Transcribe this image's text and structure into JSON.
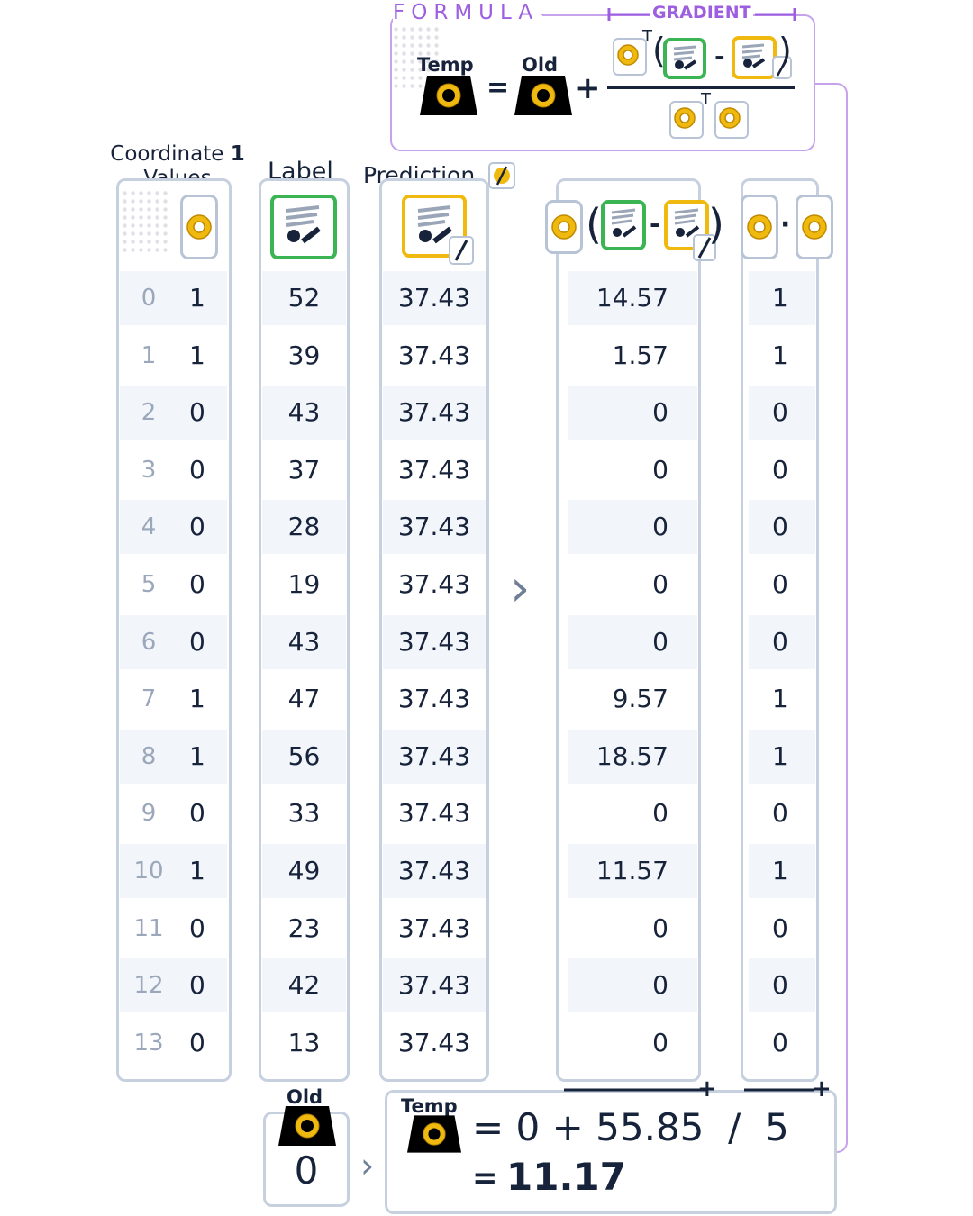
{
  "formula": {
    "title": "FORMULA",
    "gradient_label": "GRADIENT",
    "temp_label": "Temp",
    "old_label": "Old",
    "equals": "=",
    "plus": "+",
    "minus": "-",
    "transpose": "T",
    "transpose2": "T"
  },
  "columns": {
    "coordinate_header_prefix": "Coordinate",
    "coordinate_header_number": "1",
    "coordinate_header_suffix": "Values",
    "label_header": "Label",
    "prediction_header": "Prediction",
    "residual_minus": "-",
    "dot_symbol": "·"
  },
  "arrow_symbol": "›",
  "table": {
    "indices": [
      "0",
      "1",
      "2",
      "3",
      "4",
      "5",
      "6",
      "7",
      "8",
      "9",
      "10",
      "11",
      "12",
      "13"
    ],
    "coordinate_values": [
      "1",
      "1",
      "0",
      "0",
      "0",
      "0",
      "0",
      "1",
      "1",
      "0",
      "1",
      "0",
      "0",
      "0"
    ],
    "labels": [
      "52",
      "39",
      "43",
      "37",
      "28",
      "19",
      "43",
      "47",
      "56",
      "33",
      "49",
      "23",
      "42",
      "13"
    ],
    "predictions": [
      "37.43",
      "37.43",
      "37.43",
      "37.43",
      "37.43",
      "37.43",
      "37.43",
      "37.43",
      "37.43",
      "37.43",
      "37.43",
      "37.43",
      "37.43",
      "37.43"
    ],
    "residual_products": [
      "14.57",
      "1.57",
      "0",
      "0",
      "0",
      "0",
      "0",
      "9.57",
      "18.57",
      "0",
      "11.57",
      "0",
      "0",
      "0"
    ],
    "dot_products": [
      "1",
      "1",
      "0",
      "0",
      "0",
      "0",
      "0",
      "1",
      "1",
      "0",
      "1",
      "0",
      "0",
      "0"
    ]
  },
  "bottom": {
    "old_label": "Old",
    "old_value": "0",
    "temp_label": "Temp",
    "equation_line": "= 0 + 55.85  /  5",
    "result_equals": "=",
    "result_value": "11.17",
    "sum_plus_1": "+",
    "sum_plus_2": "+"
  },
  "colors": {
    "purple": "#9d5fe0",
    "green": "#3bb453",
    "gold": "#f0b90f",
    "navy": "#17233a",
    "gray_border": "#c7d0de"
  }
}
